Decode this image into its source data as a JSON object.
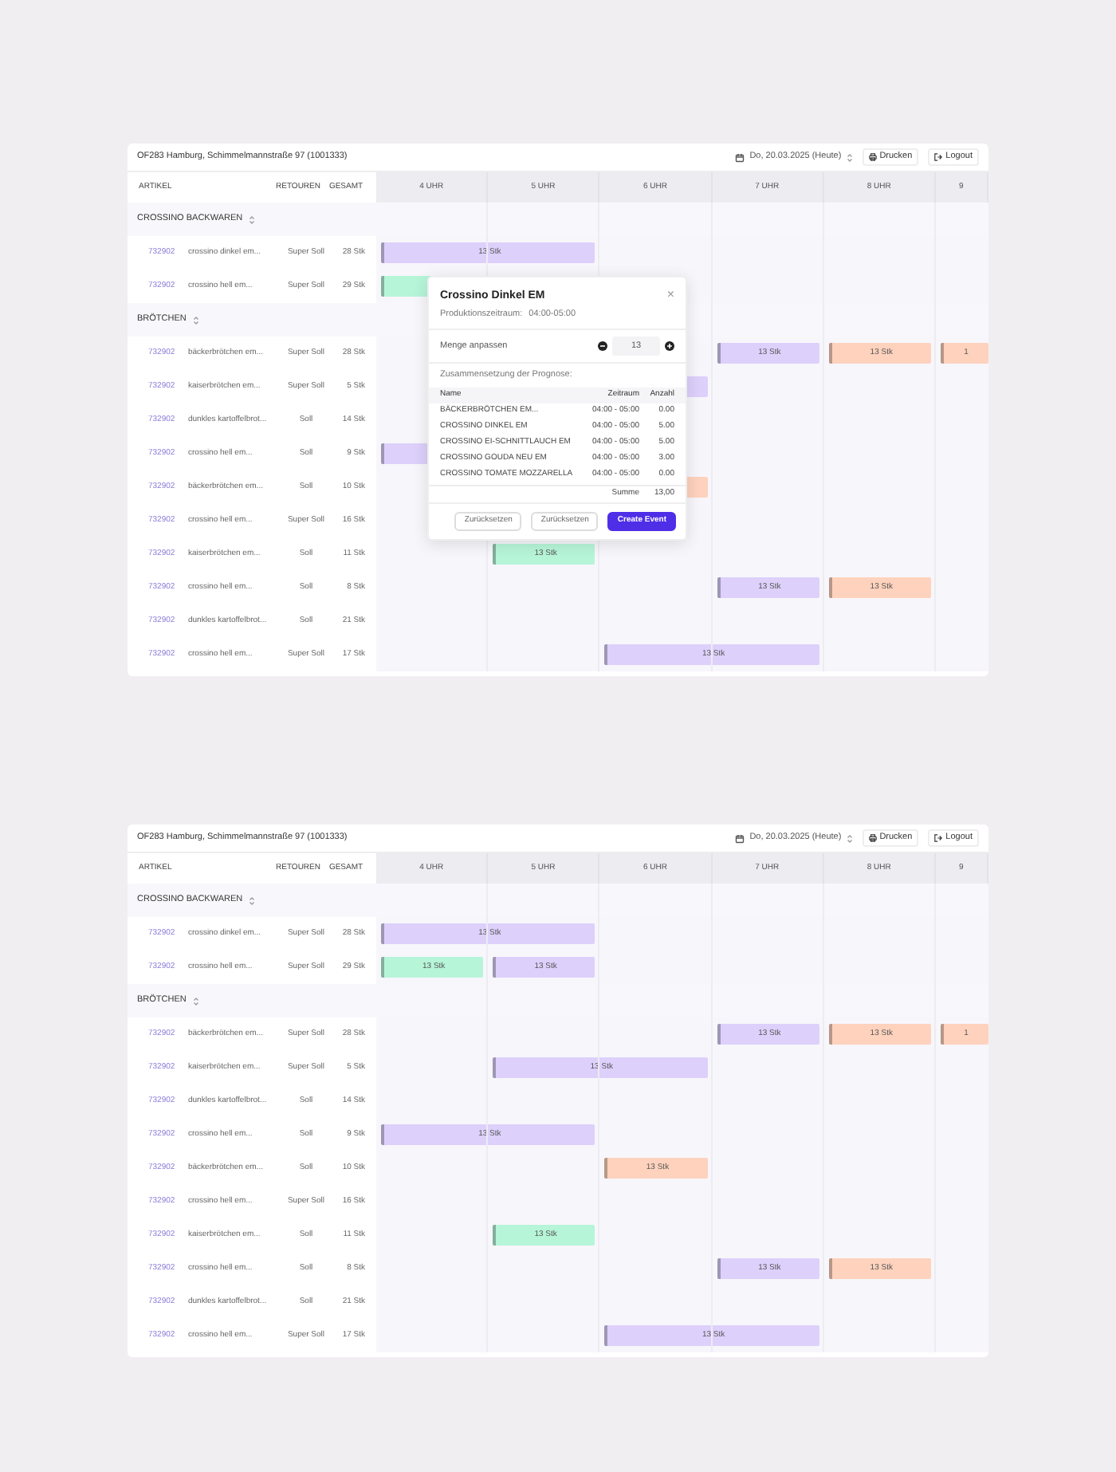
{
  "panels": [
    {
      "header": {
        "location": "OF283 Hamburg, Schimmelmannstraße 97 (1001333)",
        "date": "Do, 20.03.2025 (Heute)",
        "print": "Drucken",
        "logout": "Logout"
      },
      "columns": {
        "article": "ARTIKEL",
        "returns": "RETOUREN",
        "total": "GESAMT"
      },
      "hours": [
        "4 UHR",
        "5 UHR",
        "6 UHR",
        "7 UHR",
        "8 UHR",
        "9"
      ],
      "groups": [
        {
          "name": "CROSSINO BACKWAREN",
          "rows": [
            {
              "code": "732902",
              "name": "crossino dinkel em...",
              "returns": "Super Soll",
              "total": "28 Stk",
              "timeline": [
                {
                  "kind": "wide-bar",
                  "color": "#ddd0fb",
                  "label": "13 Stk"
                }
              ]
            },
            {
              "code": "732902",
              "name": "crossino hell em...",
              "returns": "Super Soll",
              "total": "29 Stk",
              "timeline": [
                {
                  "kind": "bar",
                  "color": "#b6f5d8"
                }
              ]
            }
          ]
        },
        {
          "name": "BRÖTCHEN",
          "rows": [
            {
              "code": "732902",
              "name": "bäckerbrötchen em...",
              "returns": "Super Soll",
              "total": "28 Stk",
              "timeline": [
                {
                  "kind": "gap"
                },
                {
                  "kind": "gap"
                },
                {
                  "kind": "gap"
                },
                {
                  "kind": "bar",
                  "color": "#ddd0fb",
                  "label": "13 Stk"
                },
                {
                  "kind": "bar",
                  "color": "#fed2bd",
                  "label": "13 Stk"
                },
                {
                  "kind": "bar",
                  "color": "#fed2bd",
                  "label": "1"
                }
              ]
            },
            {
              "code": "732902",
              "name": "kaiserbrötchen em...",
              "returns": "Super Soll",
              "total": "5 Stk",
              "timeline": [
                {
                  "kind": "gap"
                },
                {
                  "kind": "wide-bar",
                  "color": "#ddd0fb"
                }
              ]
            },
            {
              "code": "732902",
              "name": "dunkles kartoffelbrot...",
              "returns": "Soll",
              "total": "14 Stk"
            },
            {
              "code": "732902",
              "name": "crossino hell em...",
              "returns": "Soll",
              "total": "9 Stk",
              "timeline": [
                {
                  "kind": "wide-bar",
                  "color": "#ddd0fb"
                }
              ]
            },
            {
              "code": "732902",
              "name": "bäckerbrötchen em...",
              "returns": "Soll",
              "total": "10 Stk",
              "timeline": [
                {
                  "kind": "gap"
                },
                {
                  "kind": "gap"
                },
                {
                  "kind": "bar",
                  "color": "#fed2bd"
                }
              ]
            },
            {
              "code": "732902",
              "name": "crossino hell em...",
              "returns": "Super Soll",
              "total": "16 Stk"
            },
            {
              "code": "732902",
              "name": "kaiserbrötchen em...",
              "returns": "Soll",
              "total": "11 Stk",
              "timeline": [
                {
                  "kind": "gap"
                },
                {
                  "kind": "bar",
                  "color": "#b6f5d8",
                  "label": "13 Stk"
                }
              ]
            },
            {
              "code": "732902",
              "name": "crossino hell em...",
              "returns": "Soll",
              "total": "8 Stk",
              "timeline": [
                {
                  "kind": "gap"
                },
                {
                  "kind": "gap"
                },
                {
                  "kind": "gap"
                },
                {
                  "kind": "bar",
                  "color": "#ddd0fb",
                  "label": "13 Stk"
                },
                {
                  "kind": "bar",
                  "color": "#fed2bd",
                  "label": "13 Stk"
                }
              ]
            },
            {
              "code": "732902",
              "name": "dunkles kartoffelbrot...",
              "returns": "Soll",
              "total": "21 Stk"
            },
            {
              "code": "732902",
              "name": "crossino hell em...",
              "returns": "Super Soll",
              "total": "17 Stk",
              "timeline": [
                {
                  "kind": "gap"
                },
                {
                  "kind": "gap"
                },
                {
                  "kind": "wide-bar",
                  "color": "#ddd0fb",
                  "label": "13 Stk"
                }
              ]
            }
          ]
        }
      ],
      "dialog": {
        "title": "Crossino Dinkel EM",
        "period_label": "Produktionszeitraum:",
        "period": "04:00-05:00",
        "close": "×",
        "quantity_label": "Menge anpassen",
        "quantity": "13",
        "composition_label": "Zusammensetzung der Prognose:",
        "table": {
          "columns": [
            "Name",
            "Zeitraum",
            "Anzahl"
          ],
          "rows": [
            [
              "BÄCKERBRÖTCHEN EM...",
              "04:00 - 05:00",
              "0.00"
            ],
            [
              "CROSSINO DINKEL EM",
              "04:00 - 05:00",
              "5.00"
            ],
            [
              "CROSSINO EI-SCHNITTLAUCH EM",
              "04:00 - 05:00",
              "5.00"
            ],
            [
              "CROSSINO GOUDA NEU EM",
              "04:00 - 05:00",
              "3.00"
            ],
            [
              "CROSSINO TOMATE MOZZARELLA",
              "04:00 - 05:00",
              "0.00"
            ]
          ],
          "sum_label": "Summe",
          "sum": "13,00"
        },
        "buttons": [
          {
            "label": "Zurücksetzen",
            "kind": "secondary"
          },
          {
            "label": "Zurücksetzen",
            "kind": "secondary"
          },
          {
            "label": "Create Event",
            "kind": "primary"
          }
        ]
      }
    },
    {
      "header": {
        "location": "OF283 Hamburg, Schimmelmannstraße 97 (1001333)",
        "date": "Do, 20.03.2025 (Heute)",
        "print": "Drucken",
        "logout": "Logout"
      },
      "columns": {
        "article": "ARTIKEL",
        "returns": "RETOUREN",
        "total": "GESAMT"
      },
      "hours": [
        "4 UHR",
        "5 UHR",
        "6 UHR",
        "7 UHR",
        "8 UHR",
        "9"
      ],
      "groups": [
        {
          "name": "CROSSINO BACKWAREN",
          "rows": [
            {
              "code": "732902",
              "name": "crossino dinkel em...",
              "returns": "Super Soll",
              "total": "28 Stk",
              "timeline": [
                {
                  "kind": "wide-bar",
                  "color": "#ddd0fb",
                  "label": "13 Stk"
                }
              ]
            },
            {
              "code": "732902",
              "name": "crossino hell em...",
              "returns": "Super Soll",
              "total": "29 Stk",
              "timeline": [
                {
                  "kind": "bar",
                  "color": "#b6f5d8",
                  "label": "13 Stk"
                },
                {
                  "kind": "bar",
                  "color": "#ddd0fb",
                  "label": "13 Stk"
                }
              ]
            }
          ]
        },
        {
          "name": "BRÖTCHEN",
          "rows": [
            {
              "code": "732902",
              "name": "bäckerbrötchen em...",
              "returns": "Super Soll",
              "total": "28 Stk",
              "timeline": [
                {
                  "kind": "gap"
                },
                {
                  "kind": "gap"
                },
                {
                  "kind": "gap"
                },
                {
                  "kind": "bar",
                  "color": "#ddd0fb",
                  "label": "13 Stk"
                },
                {
                  "kind": "bar",
                  "color": "#fed2bd",
                  "label": "13 Stk"
                },
                {
                  "kind": "bar",
                  "color": "#fed2bd",
                  "label": "1"
                }
              ]
            },
            {
              "code": "732902",
              "name": "kaiserbrötchen em...",
              "returns": "Super Soll",
              "total": "5 Stk",
              "timeline": [
                {
                  "kind": "gap"
                },
                {
                  "kind": "wide-bar",
                  "color": "#ddd0fb",
                  "label": "13 Stk"
                }
              ]
            },
            {
              "code": "732902",
              "name": "dunkles kartoffelbrot...",
              "returns": "Soll",
              "total": "14 Stk"
            },
            {
              "code": "732902",
              "name": "crossino hell em...",
              "returns": "Soll",
              "total": "9 Stk",
              "timeline": [
                {
                  "kind": "wide-bar",
                  "color": "#ddd0fb",
                  "label": "13 Stk"
                }
              ]
            },
            {
              "code": "732902",
              "name": "bäckerbrötchen em...",
              "returns": "Soll",
              "total": "10 Stk",
              "timeline": [
                {
                  "kind": "gap"
                },
                {
                  "kind": "gap"
                },
                {
                  "kind": "bar",
                  "color": "#fed2bd",
                  "label": "13 Stk"
                }
              ]
            },
            {
              "code": "732902",
              "name": "crossino hell em...",
              "returns": "Super Soll",
              "total": "16 Stk"
            },
            {
              "code": "732902",
              "name": "kaiserbrötchen em...",
              "returns": "Soll",
              "total": "11 Stk",
              "timeline": [
                {
                  "kind": "gap"
                },
                {
                  "kind": "bar",
                  "color": "#b6f5d8",
                  "label": "13 Stk"
                }
              ]
            },
            {
              "code": "732902",
              "name": "crossino hell em...",
              "returns": "Soll",
              "total": "8 Stk",
              "timeline": [
                {
                  "kind": "gap"
                },
                {
                  "kind": "gap"
                },
                {
                  "kind": "gap"
                },
                {
                  "kind": "bar",
                  "color": "#ddd0fb",
                  "label": "13 Stk"
                },
                {
                  "kind": "bar",
                  "color": "#fed2bd",
                  "label": "13 Stk"
                }
              ]
            },
            {
              "code": "732902",
              "name": "dunkles kartoffelbrot...",
              "returns": "Soll",
              "total": "21 Stk"
            },
            {
              "code": "732902",
              "name": "crossino hell em...",
              "returns": "Super Soll",
              "total": "17 Stk",
              "timeline": [
                {
                  "kind": "gap"
                },
                {
                  "kind": "gap"
                },
                {
                  "kind": "wide-bar",
                  "color": "#ddd0fb",
                  "label": "13 Stk"
                }
              ]
            }
          ]
        }
      ]
    }
  ]
}
